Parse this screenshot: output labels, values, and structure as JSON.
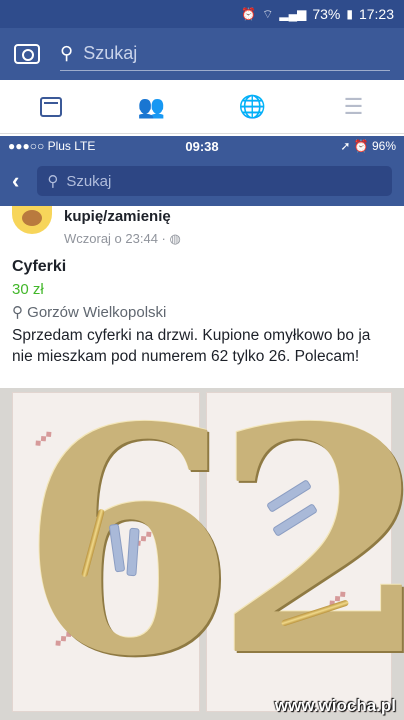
{
  "android_status": {
    "battery": "73%",
    "time": "17:23",
    "icons": [
      "alarm-icon",
      "wifi-icon",
      "signal-icon",
      "battery-icon"
    ]
  },
  "fb_top": {
    "search_placeholder": "Szukaj",
    "icons": [
      "camera-icon",
      "search-icon"
    ]
  },
  "fb_tabs": {
    "icons": [
      "news-feed-icon",
      "friends-icon",
      "globe-icon",
      "menu-icon"
    ],
    "active_color": "#3b5998",
    "inactive_color": "#b6bccb"
  },
  "ios_status": {
    "carrier": "●●●○○ Plus  LTE",
    "time": "09:38",
    "right": "➚ ⏰ 96%"
  },
  "ios_nav": {
    "search_placeholder": "Szukaj"
  },
  "post": {
    "group_name": "kupię/zamienię",
    "time": "Wczoraj o 23:44 · ",
    "title": "Cyferki",
    "price": "30 zł",
    "location": "Gorzów Wielkopolski",
    "description": "Sprzedam cyferki na drzwi. Kupione omyłkowo bo ja nie mieszkam pod numerem 62 tylko 26. Polecam!"
  },
  "photo": {
    "digit_left": "6",
    "digit_right": "2",
    "watermark": "www.wiocha.pl"
  },
  "colors": {
    "fb_blue": "#3b5998",
    "price_green": "#42b72a"
  }
}
